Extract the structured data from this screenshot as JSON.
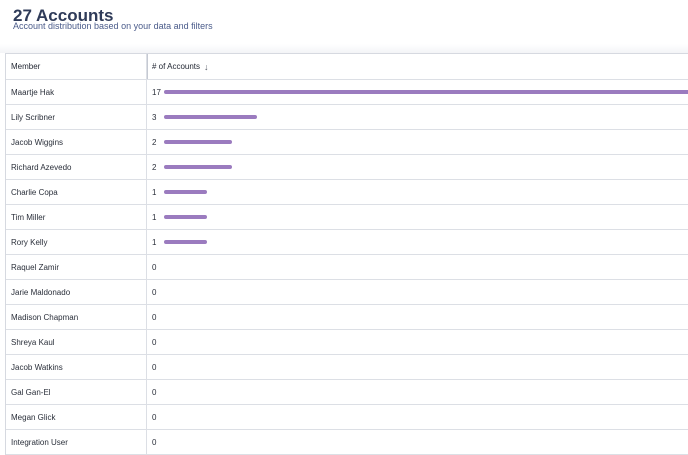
{
  "header": {
    "title": "27 Accounts",
    "subtitle": "Account distribution based on your data and filters"
  },
  "table": {
    "columns": {
      "member": "Member",
      "accounts": "# of Accounts",
      "sort_icon": "arrow-down-icon"
    },
    "bar_color": "#9b7bbf",
    "rows": [
      {
        "member": "Maartje Hak",
        "count": "17"
      },
      {
        "member": "Lily Scribner",
        "count": "3"
      },
      {
        "member": "Jacob Wiggins",
        "count": "2"
      },
      {
        "member": "Richard Azevedo",
        "count": "2"
      },
      {
        "member": "Charlie Copa",
        "count": "1"
      },
      {
        "member": "Tim Miller",
        "count": "1"
      },
      {
        "member": "Rory Kelly",
        "count": "1"
      },
      {
        "member": "Raquel Zamir",
        "count": "0"
      },
      {
        "member": "Jarie Maldonado",
        "count": "0"
      },
      {
        "member": "Madison Chapman",
        "count": "0"
      },
      {
        "member": "Shreya Kaul",
        "count": "0"
      },
      {
        "member": "Jacob Watkins",
        "count": "0"
      },
      {
        "member": "Gal Gan-El",
        "count": "0"
      },
      {
        "member": "Megan Glick",
        "count": "0"
      },
      {
        "member": "Integration User",
        "count": "0"
      }
    ]
  }
}
